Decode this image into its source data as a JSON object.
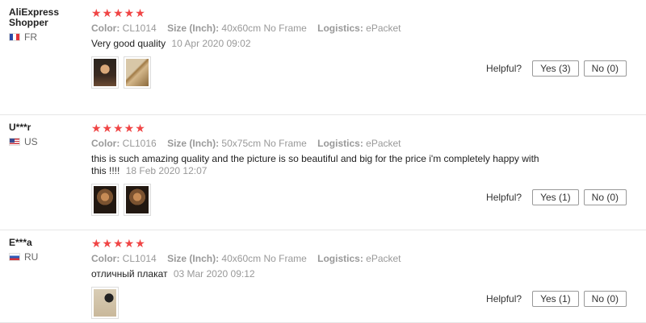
{
  "labels": {
    "color": "Color:",
    "size": "Size (Inch):",
    "logistics": "Logistics:",
    "helpful": "Helpful?",
    "stars": "★★★★★"
  },
  "colors": {
    "star": "#f04545",
    "meta": "#999999"
  },
  "reviews": [
    {
      "user": "AliExpress Shopper",
      "country": "FR",
      "flag_icon": "flag-france-icon",
      "rating": 5,
      "color": "CL1014",
      "size": "40x60cm No Frame",
      "logistics": "ePacket",
      "text": "Very good quality",
      "date": "10 Apr 2020 09:02",
      "photos": [
        "photo-face",
        "photo-gold"
      ],
      "yes": "Yes (3)",
      "no": "No (0)"
    },
    {
      "user": "U***r",
      "country": "US",
      "flag_icon": "flag-us-icon",
      "rating": 5,
      "color": "CL1016",
      "size": "50x75cm No Frame",
      "logistics": "ePacket",
      "text": "this is such amazing quality and the picture is so beautiful and big for the price i'm completely happy with this !!!!",
      "date": "18 Feb 2020 12:07",
      "photos": [
        "photo-dark",
        "photo-dark"
      ],
      "yes": "Yes (1)",
      "no": "No (0)"
    },
    {
      "user": "E***a",
      "country": "RU",
      "flag_icon": "flag-russia-icon",
      "rating": 5,
      "color": "CL1014",
      "size": "40x60cm No Frame",
      "logistics": "ePacket",
      "text": "отличный плакат",
      "date": "03 Mar 2020 09:12",
      "photos": [
        "photo-wall"
      ],
      "yes": "Yes (1)",
      "no": "No (0)"
    }
  ]
}
